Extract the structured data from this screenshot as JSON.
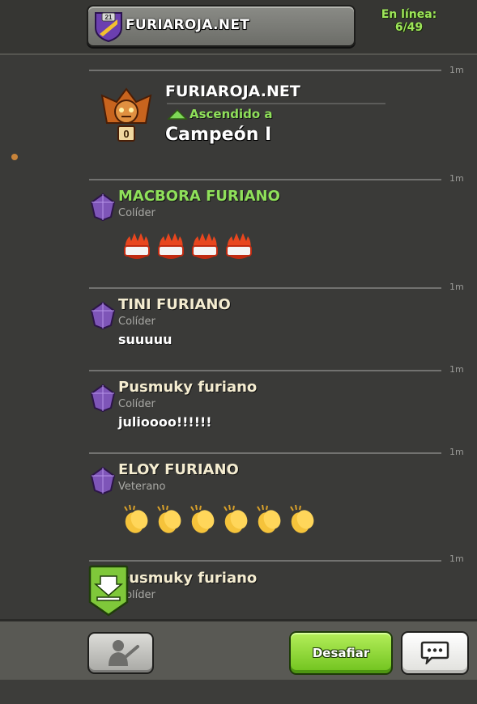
{
  "header": {
    "clan_level": "21",
    "clan_name": "FURIAROJA.NET",
    "online_label": "En línea:",
    "online_count": "6/49"
  },
  "promotion": {
    "time": "1m",
    "clan_name": "FURIAROJA.NET",
    "status": "Ascendido a",
    "league": "Campeón I",
    "league_number": "0"
  },
  "messages": [
    {
      "time": "1m",
      "author": "MACBORA FURIANO",
      "role": "Colíder",
      "author_color": "#8fe05a",
      "content_type": "emoji",
      "emoji": "fire",
      "emoji_count": 4
    },
    {
      "time": "1m",
      "author": "TINI FURIANO",
      "role": "Colíder",
      "author_color": "#f4ecd0",
      "text": "suuuuu"
    },
    {
      "time": "1m",
      "author": "Pusmuky furiano",
      "role": "Colíder",
      "author_color": "#f4ecd0",
      "text": "juliοooo!!!!!!"
    },
    {
      "time": "1m",
      "author": "ELOY FURIANO",
      "role": "Veterano",
      "author_color": "#f4ecd0",
      "content_type": "emoji",
      "emoji": "clapping-hands",
      "emoji_count": 6
    },
    {
      "time": "1m",
      "author": "Pusmuky furiano",
      "role": "Colíder",
      "author_color": "#f4ecd0"
    }
  ],
  "bottom": {
    "challenge_label": "Desafiar"
  },
  "colors": {
    "accent_green": "#8fe05a",
    "promotion_arrow": "#7ed957"
  }
}
